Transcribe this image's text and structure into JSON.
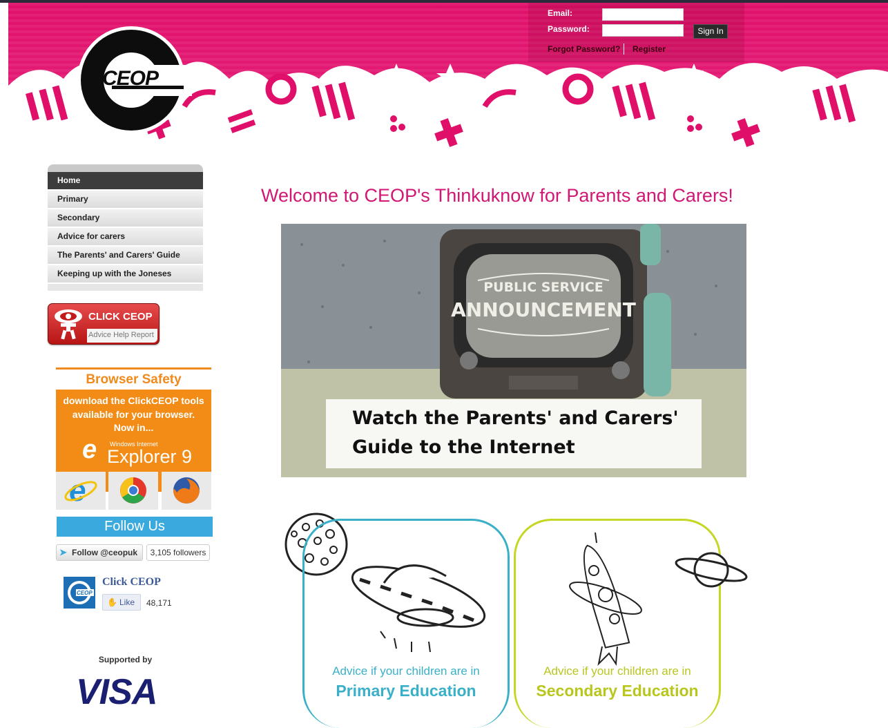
{
  "login": {
    "email_label": "Email:",
    "password_label": "Password:",
    "signin_label": "Sign In",
    "forgot_label": "Forgot Password?",
    "register_label": "Register"
  },
  "logo_text": "CEOP",
  "nav": {
    "items": [
      {
        "label": "Home",
        "active": true
      },
      {
        "label": "Primary"
      },
      {
        "label": "Secondary"
      },
      {
        "label": "Advice for carers"
      },
      {
        "label": "The Parents' and Carers' Guide"
      },
      {
        "label": "Keeping up with the Joneses"
      }
    ]
  },
  "clickceop": {
    "title": "CLICK CEOP",
    "subtitle": "Advice Help Report"
  },
  "browser_safety": {
    "title": "Browser Safety",
    "line1": "download the ClickCEOP tools",
    "line2": "available for your browser.",
    "line3": "Now in...",
    "ie_small": "Windows Internet",
    "ie_big": "Explorer 9"
  },
  "follow": {
    "bar": "Follow Us",
    "twitter_label": "Follow @ceopuk",
    "followers": "3,105 followers"
  },
  "facebook": {
    "name": "Click CEOP",
    "like": "Like",
    "count": "48,171"
  },
  "supported": {
    "label": "Supported by",
    "brand": "VISA"
  },
  "main": {
    "welcome": "Welcome to CEOP's Thinkuknow for Parents and Carers!",
    "video": {
      "tv_line1": "PUBLIC SERVICE",
      "tv_line2": "ANNOUNCEMENT",
      "caption1": "Watch the Parents' and Carers'",
      "caption2": "Guide to the Internet"
    },
    "primary": {
      "small": "Advice if your children are in",
      "big": "Primary Education"
    },
    "secondary": {
      "small": "Advice if your children are in",
      "big": "Secondary Education"
    }
  },
  "colors": {
    "brand_pink": "#d01774",
    "header_pink": "#e2156e",
    "primary_teal": "#39b0c7",
    "secondary_lime": "#c5d725",
    "twitter_blue": "#39a9de",
    "orange": "#f28c16"
  }
}
